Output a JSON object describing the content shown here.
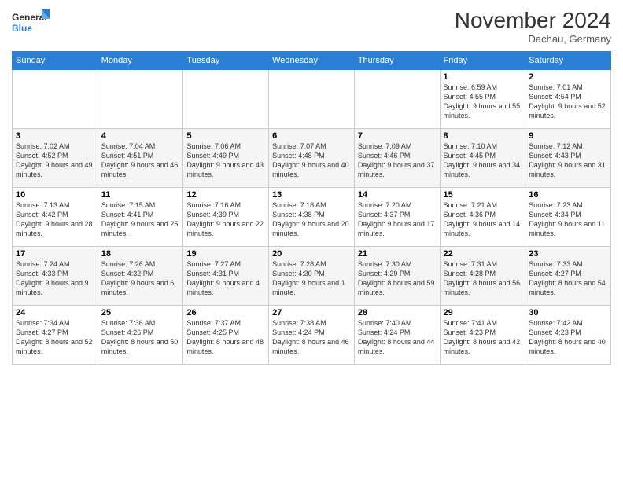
{
  "logo": {
    "line1": "General",
    "line2": "Blue"
  },
  "title": "November 2024",
  "location": "Dachau, Germany",
  "weekdays": [
    "Sunday",
    "Monday",
    "Tuesday",
    "Wednesday",
    "Thursday",
    "Friday",
    "Saturday"
  ],
  "weeks": [
    [
      {
        "day": "",
        "info": ""
      },
      {
        "day": "",
        "info": ""
      },
      {
        "day": "",
        "info": ""
      },
      {
        "day": "",
        "info": ""
      },
      {
        "day": "",
        "info": ""
      },
      {
        "day": "1",
        "info": "Sunrise: 6:59 AM\nSunset: 4:55 PM\nDaylight: 9 hours and 55 minutes."
      },
      {
        "day": "2",
        "info": "Sunrise: 7:01 AM\nSunset: 4:54 PM\nDaylight: 9 hours and 52 minutes."
      }
    ],
    [
      {
        "day": "3",
        "info": "Sunrise: 7:02 AM\nSunset: 4:52 PM\nDaylight: 9 hours and 49 minutes."
      },
      {
        "day": "4",
        "info": "Sunrise: 7:04 AM\nSunset: 4:51 PM\nDaylight: 9 hours and 46 minutes."
      },
      {
        "day": "5",
        "info": "Sunrise: 7:06 AM\nSunset: 4:49 PM\nDaylight: 9 hours and 43 minutes."
      },
      {
        "day": "6",
        "info": "Sunrise: 7:07 AM\nSunset: 4:48 PM\nDaylight: 9 hours and 40 minutes."
      },
      {
        "day": "7",
        "info": "Sunrise: 7:09 AM\nSunset: 4:46 PM\nDaylight: 9 hours and 37 minutes."
      },
      {
        "day": "8",
        "info": "Sunrise: 7:10 AM\nSunset: 4:45 PM\nDaylight: 9 hours and 34 minutes."
      },
      {
        "day": "9",
        "info": "Sunrise: 7:12 AM\nSunset: 4:43 PM\nDaylight: 9 hours and 31 minutes."
      }
    ],
    [
      {
        "day": "10",
        "info": "Sunrise: 7:13 AM\nSunset: 4:42 PM\nDaylight: 9 hours and 28 minutes."
      },
      {
        "day": "11",
        "info": "Sunrise: 7:15 AM\nSunset: 4:41 PM\nDaylight: 9 hours and 25 minutes."
      },
      {
        "day": "12",
        "info": "Sunrise: 7:16 AM\nSunset: 4:39 PM\nDaylight: 9 hours and 22 minutes."
      },
      {
        "day": "13",
        "info": "Sunrise: 7:18 AM\nSunset: 4:38 PM\nDaylight: 9 hours and 20 minutes."
      },
      {
        "day": "14",
        "info": "Sunrise: 7:20 AM\nSunset: 4:37 PM\nDaylight: 9 hours and 17 minutes."
      },
      {
        "day": "15",
        "info": "Sunrise: 7:21 AM\nSunset: 4:36 PM\nDaylight: 9 hours and 14 minutes."
      },
      {
        "day": "16",
        "info": "Sunrise: 7:23 AM\nSunset: 4:34 PM\nDaylight: 9 hours and 11 minutes."
      }
    ],
    [
      {
        "day": "17",
        "info": "Sunrise: 7:24 AM\nSunset: 4:33 PM\nDaylight: 9 hours and 9 minutes."
      },
      {
        "day": "18",
        "info": "Sunrise: 7:26 AM\nSunset: 4:32 PM\nDaylight: 9 hours and 6 minutes."
      },
      {
        "day": "19",
        "info": "Sunrise: 7:27 AM\nSunset: 4:31 PM\nDaylight: 9 hours and 4 minutes."
      },
      {
        "day": "20",
        "info": "Sunrise: 7:28 AM\nSunset: 4:30 PM\nDaylight: 9 hours and 1 minute."
      },
      {
        "day": "21",
        "info": "Sunrise: 7:30 AM\nSunset: 4:29 PM\nDaylight: 8 hours and 59 minutes."
      },
      {
        "day": "22",
        "info": "Sunrise: 7:31 AM\nSunset: 4:28 PM\nDaylight: 8 hours and 56 minutes."
      },
      {
        "day": "23",
        "info": "Sunrise: 7:33 AM\nSunset: 4:27 PM\nDaylight: 8 hours and 54 minutes."
      }
    ],
    [
      {
        "day": "24",
        "info": "Sunrise: 7:34 AM\nSunset: 4:27 PM\nDaylight: 8 hours and 52 minutes."
      },
      {
        "day": "25",
        "info": "Sunrise: 7:36 AM\nSunset: 4:26 PM\nDaylight: 8 hours and 50 minutes."
      },
      {
        "day": "26",
        "info": "Sunrise: 7:37 AM\nSunset: 4:25 PM\nDaylight: 8 hours and 48 minutes."
      },
      {
        "day": "27",
        "info": "Sunrise: 7:38 AM\nSunset: 4:24 PM\nDaylight: 8 hours and 46 minutes."
      },
      {
        "day": "28",
        "info": "Sunrise: 7:40 AM\nSunset: 4:24 PM\nDaylight: 8 hours and 44 minutes."
      },
      {
        "day": "29",
        "info": "Sunrise: 7:41 AM\nSunset: 4:23 PM\nDaylight: 8 hours and 42 minutes."
      },
      {
        "day": "30",
        "info": "Sunrise: 7:42 AM\nSunset: 4:23 PM\nDaylight: 8 hours and 40 minutes."
      }
    ]
  ]
}
